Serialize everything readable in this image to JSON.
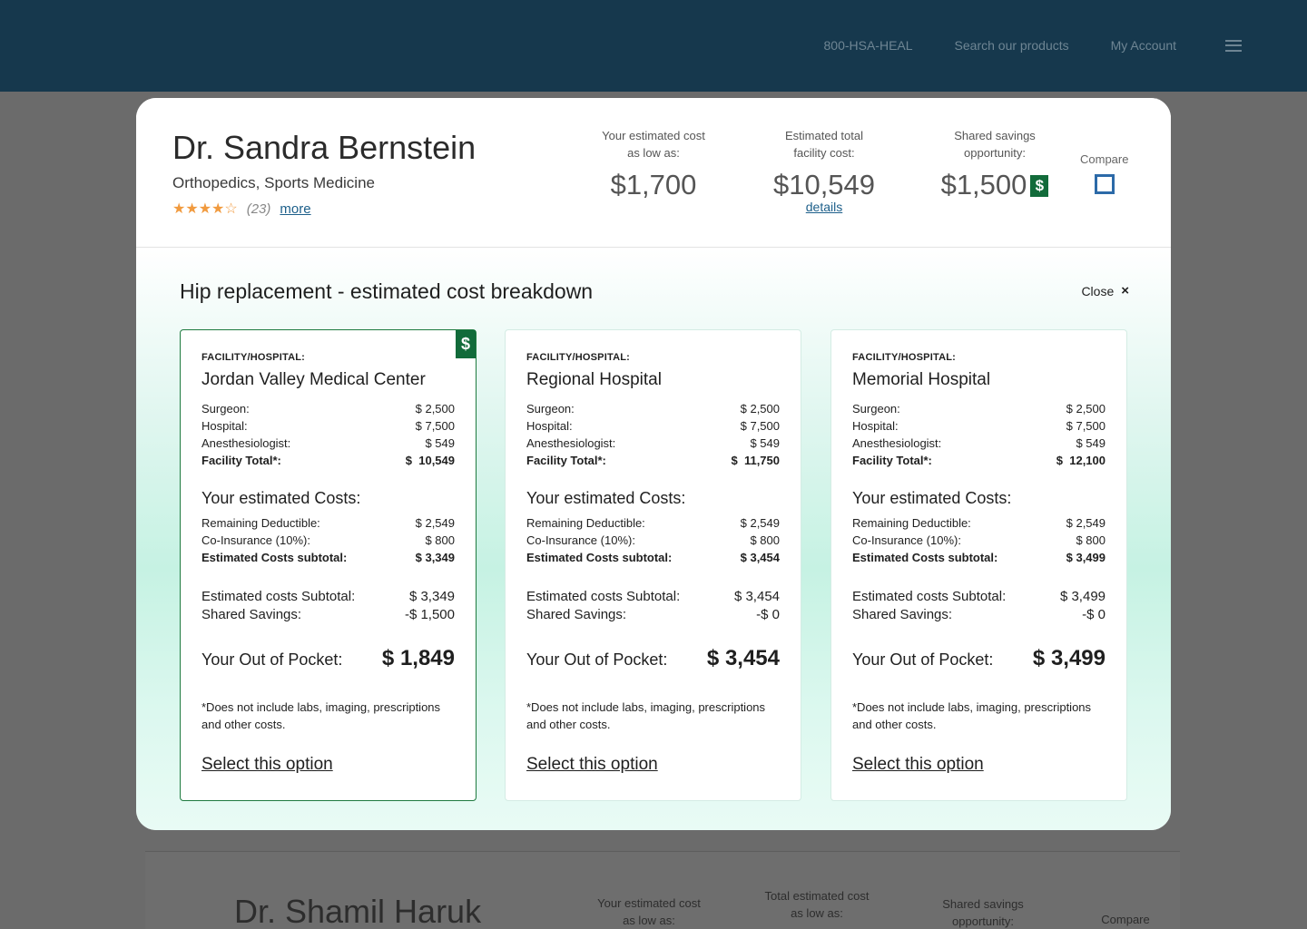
{
  "topnav": {
    "phone": "800-HSA-HEAL",
    "search": "Search our products",
    "account": "My Account"
  },
  "background": {
    "doctor_name": "Dr. Shamil Haruk",
    "col1": "Your estimated cost\nas low as:",
    "col2": "Total estimated cost\nas low as:",
    "col3": "Shared savings\nopportunity:",
    "compare": "Compare"
  },
  "modal": {
    "doctor_name": "Dr. Sandra Bernstein",
    "specialty": "Orthopedics, Sports Medicine",
    "rating": {
      "stars": 4,
      "max": 5,
      "count": "(23)",
      "more": "more"
    },
    "stats": {
      "cost_label_1": "Your estimated cost",
      "cost_label_2": "as low as:",
      "cost_value": "$1,700",
      "facility_label_1": "Estimated total",
      "facility_label_2": "facility cost:",
      "facility_value": "$10,549",
      "facility_details": "details",
      "savings_label_1": "Shared savings",
      "savings_label_2": "opportunity:",
      "savings_value": "$1,500",
      "savings_badge": "$",
      "compare_label": "Compare"
    },
    "breakdown_title": "Hip replacement - estimated cost breakdown",
    "close_label": "Close",
    "close_icon": "×"
  },
  "cards": [
    {
      "facility_label": "FACILITY/HOSPITAL:",
      "name": "Jordan Valley Medical Center",
      "surgeon": "$ 2,500",
      "hospital": "$ 7,500",
      "anesthesiologist": "$ 549",
      "facility_total": "$  10,549",
      "deductible": "$ 2,549",
      "coinsurance": "$ 800",
      "est_subtotal": "$ 3,349",
      "costs_subtotal": "$ 3,349",
      "shared_savings": "-$ 1,500",
      "out_of_pocket": "$ 1,849",
      "badge": "$"
    },
    {
      "facility_label": "FACILITY/HOSPITAL:",
      "name": "Regional Hospital",
      "surgeon": "$ 2,500",
      "hospital": "$ 7,500",
      "anesthesiologist": "$ 549",
      "facility_total": "$  11,750",
      "deductible": "$ 2,549",
      "coinsurance": "$ 800",
      "est_subtotal": "$ 3,454",
      "costs_subtotal": "$ 3,454",
      "shared_savings": "-$ 0",
      "out_of_pocket": "$ 3,454"
    },
    {
      "facility_label": "FACILITY/HOSPITAL:",
      "name": "Memorial Hospital",
      "surgeon": "$ 2,500",
      "hospital": "$ 7,500",
      "anesthesiologist": "$ 549",
      "facility_total": "$  12,100",
      "deductible": "$ 2,549",
      "coinsurance": "$ 800",
      "est_subtotal": "$ 3,499",
      "costs_subtotal": "$ 3,499",
      "shared_savings": "-$ 0",
      "out_of_pocket": "$ 3,499"
    }
  ],
  "labels": {
    "surgeon": "Surgeon:",
    "hospital": "Hospital:",
    "anesthesiologist": "Anesthesiologist:",
    "facility_total": "Facility Total*:",
    "your_costs": "Your estimated Costs:",
    "deductible": "Remaining Deductible:",
    "coinsurance": "Co-Insurance (10%):",
    "est_subtotal": "Estimated Costs subtotal:",
    "costs_subtotal": "Estimated costs Subtotal:",
    "shared_savings": "Shared Savings:",
    "out_of_pocket": "Your Out of Pocket:",
    "disclaimer": "*Does not include labs, imaging, prescriptions and other costs.",
    "select": "Select this option"
  },
  "colors": {
    "nav_bg": "#16384d",
    "accent_green": "#126b3a",
    "link_blue": "#1d5f8a",
    "star": "#f19a3e"
  }
}
